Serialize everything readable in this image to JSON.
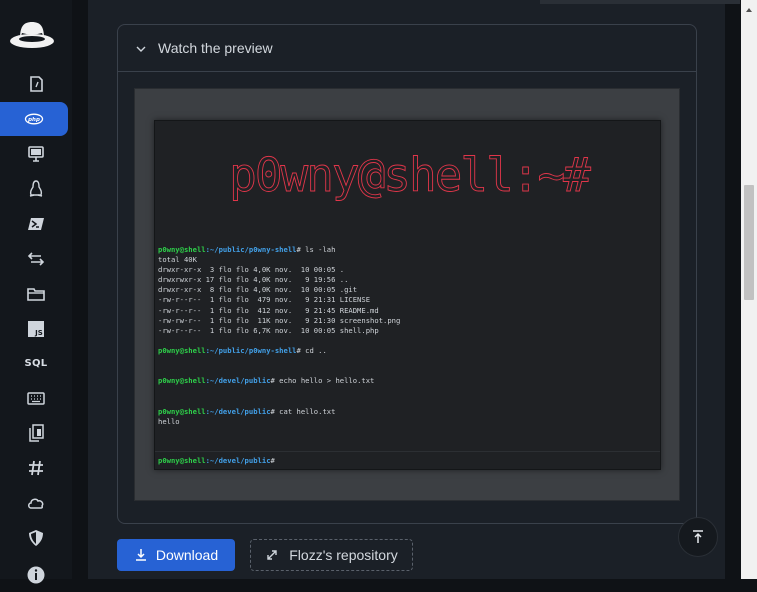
{
  "sidebar": {
    "items": [
      {
        "name": "nav-item-hacktricks",
        "icon": "file-code-icon"
      },
      {
        "name": "nav-item-php",
        "icon": "php-icon",
        "active": true
      },
      {
        "name": "nav-item-desktop",
        "icon": "monitor-icon"
      },
      {
        "name": "nav-item-linux",
        "icon": "linux-icon"
      },
      {
        "name": "nav-item-powershell",
        "icon": "powershell-icon"
      },
      {
        "name": "nav-item-reverse",
        "icon": "arrows-exchange-icon"
      },
      {
        "name": "nav-item-folder",
        "icon": "folder-icon"
      },
      {
        "name": "nav-item-js",
        "icon": "js-icon",
        "label": "JS"
      },
      {
        "name": "nav-item-sql",
        "icon": "sql-icon",
        "label": "SQL"
      },
      {
        "name": "nav-item-keyboard",
        "icon": "keyboard-icon"
      },
      {
        "name": "nav-item-copy",
        "icon": "copy-icon"
      },
      {
        "name": "nav-item-hash",
        "icon": "hash-icon"
      },
      {
        "name": "nav-item-cloud",
        "icon": "cloud-icon"
      },
      {
        "name": "nav-item-shield",
        "icon": "shield-icon"
      },
      {
        "name": "nav-item-info",
        "icon": "info-icon"
      }
    ]
  },
  "panel": {
    "title": "Watch the preview"
  },
  "terminal": {
    "banner": "p0wny@shell:~#",
    "lines": [
      {
        "user": "p0wny@shell",
        "path": ":~/public/p0wny-shell",
        "cmd": "# ls -lah"
      },
      {
        "text": "total 40K"
      },
      {
        "text": "drwxr-xr-x  3 flo flo 4,0K nov.  10 00:05 ."
      },
      {
        "text": "drwxrwxr-x 17 flo flo 4,0K nov.   9 19:56 .."
      },
      {
        "text": "drwxr-xr-x  8 flo flo 4,0K nov.  10 00:05 .git"
      },
      {
        "text": "-rw-r--r--  1 flo flo  479 nov.   9 21:31 LICENSE"
      },
      {
        "text": "-rw-r--r--  1 flo flo  412 nov.   9 21:45 README.md"
      },
      {
        "text": "-rw-rw-r--  1 flo flo  11K nov.   9 21:30 screenshot.png"
      },
      {
        "text": "-rw-r--r--  1 flo flo 6,7K nov.  10 00:05 shell.php"
      },
      {
        "text": ""
      },
      {
        "user": "p0wny@shell",
        "path": ":~/public/p0wny-shell",
        "cmd": "# cd .."
      },
      {
        "text": ""
      },
      {
        "text": ""
      },
      {
        "user": "p0wny@shell",
        "path": ":~/devel/public",
        "cmd": "# echo hello > hello.txt"
      },
      {
        "text": ""
      },
      {
        "text": ""
      },
      {
        "user": "p0wny@shell",
        "path": ":~/devel/public",
        "cmd": "# cat hello.txt"
      },
      {
        "text": "hello"
      }
    ],
    "input_prompt": {
      "user": "p0wny@shell",
      "path": ":~/devel/public",
      "cmd": "#"
    }
  },
  "buttons": {
    "download": "Download",
    "repository": "Flozz's repository"
  },
  "colors": {
    "accent": "#2762d4",
    "prompt_user": "#2ecf4a",
    "prompt_path": "#42a0e8",
    "banner": "#e0364a"
  }
}
